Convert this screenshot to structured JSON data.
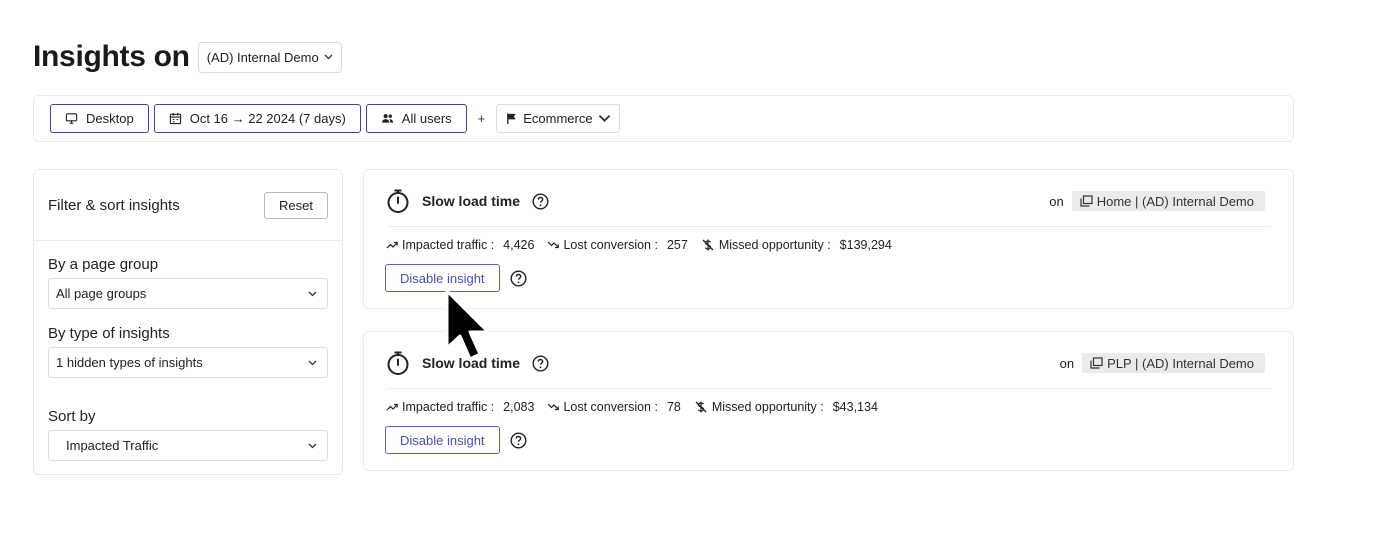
{
  "header": {
    "title": "Insights on",
    "app_select": "(AD) Internal Demo"
  },
  "filters": {
    "device": "Desktop",
    "date_range": "Oct 16 → 22 2024 (7 days)",
    "segment": "All users",
    "plus": "+",
    "goal": "Ecommerce"
  },
  "sidebar": {
    "title": "Filter & sort insights",
    "reset_label": "Reset",
    "page_group_label": "By a page group",
    "page_group_value": "All page groups",
    "type_label": "By type of insights",
    "type_value": "1 hidden types of insights",
    "sort_label": "Sort by",
    "sort_value": "Impacted Traffic"
  },
  "insights": [
    {
      "title": "Slow load time",
      "on_label": "on",
      "page": "Home | (AD) Internal Demo",
      "impacted_label": "Impacted traffic :",
      "impacted_value": "4,426",
      "lost_label": "Lost conversion :",
      "lost_value": "257",
      "missed_label": "Missed opportunity :",
      "missed_value": "$139,294",
      "disable_label": "Disable insight"
    },
    {
      "title": "Slow load time",
      "on_label": "on",
      "page": "PLP | (AD) Internal Demo",
      "impacted_label": "Impacted traffic :",
      "impacted_value": "2,083",
      "lost_label": "Lost conversion :",
      "lost_value": "78",
      "missed_label": "Missed opportunity :",
      "missed_value": "$43,134",
      "disable_label": "Disable insight"
    }
  ],
  "colors": {
    "chip_border": "#3c4a8d",
    "accent": "#4a4fb0",
    "tag_bg": "#ebebeb"
  }
}
